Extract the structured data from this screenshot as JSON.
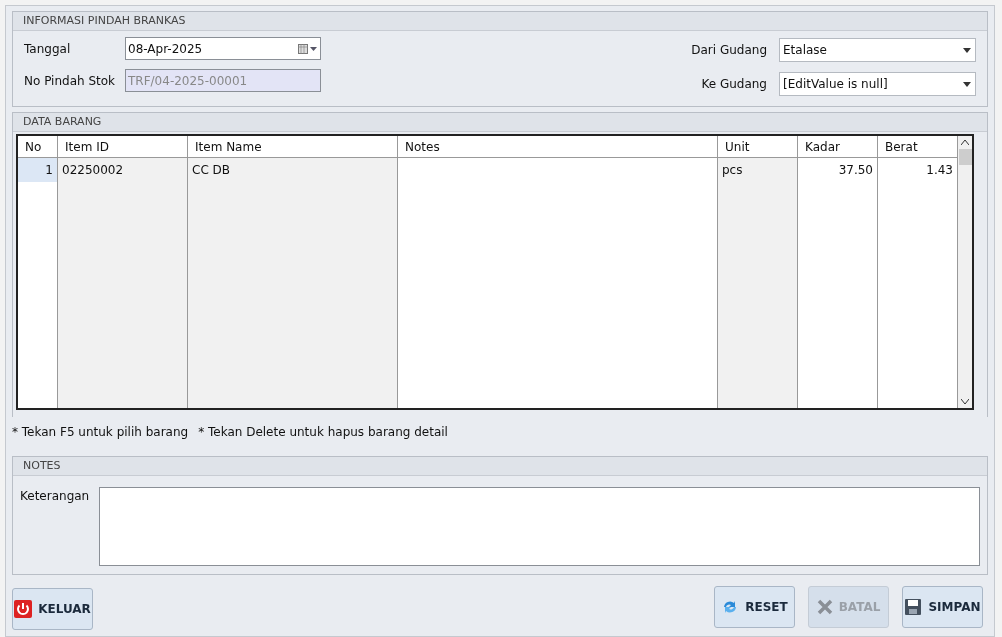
{
  "info": {
    "title": "INFORMASI PINDAH BRANKAS",
    "tanggal": {
      "label": "Tanggal",
      "value": "08-Apr-2025"
    },
    "no_pindah": {
      "label": "No Pindah Stok",
      "value": "TRF/04-2025-00001",
      "disabled": true
    },
    "dari": {
      "label": "Dari Gudang",
      "value": "Etalase"
    },
    "ke": {
      "label": "Ke Gudang",
      "value": "[EditValue is null]"
    }
  },
  "data": {
    "title": "DATA BARANG",
    "columns": [
      {
        "label": "No",
        "readonly": false,
        "kind": "number"
      },
      {
        "label": "Item ID",
        "readonly": true,
        "kind": "text"
      },
      {
        "label": "Item Name",
        "readonly": true,
        "kind": "text"
      },
      {
        "label": "Notes",
        "readonly": false,
        "kind": "text"
      },
      {
        "label": "Unit",
        "readonly": true,
        "kind": "text"
      },
      {
        "label": "Kadar",
        "readonly": false,
        "kind": "number"
      },
      {
        "label": "Berat",
        "readonly": false,
        "kind": "number"
      }
    ],
    "rows": [
      {
        "selected": true,
        "cells": [
          "1",
          "02250002",
          "CC DB",
          "",
          "pcs",
          "37.50",
          "1.43"
        ]
      }
    ]
  },
  "hints": [
    "* Tekan F5 untuk pilih barang",
    "* Tekan Delete untuk hapus barang detail"
  ],
  "notes": {
    "title": "NOTES",
    "label": "Keterangan"
  },
  "buttons": [
    {
      "kind": "exit",
      "label": "KELUAR",
      "disabled": false
    },
    {
      "kind": "reset",
      "label": "RESET",
      "disabled": false
    },
    {
      "kind": "cancel",
      "label": "BATAL",
      "disabled": true
    },
    {
      "kind": "save",
      "label": "SIMPAN",
      "disabled": false
    }
  ]
}
